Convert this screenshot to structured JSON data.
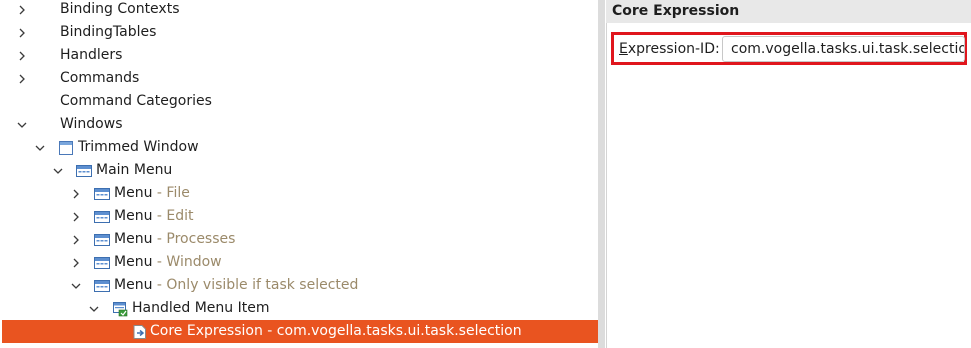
{
  "tree": {
    "items": [
      {
        "label": "Binding Contexts",
        "expander": "collapsed"
      },
      {
        "label": "BindingTables",
        "expander": "collapsed"
      },
      {
        "label": "Handlers",
        "expander": "collapsed"
      },
      {
        "label": "Commands",
        "expander": "collapsed"
      },
      {
        "label": "Command Categories",
        "expander": "none"
      },
      {
        "label": "Windows",
        "expander": "expanded"
      },
      {
        "label": "Trimmed Window",
        "icon": "window-icon",
        "expander": "expanded"
      },
      {
        "label": "Main Menu",
        "icon": "menu-icon",
        "expander": "expanded"
      },
      {
        "label": "Menu",
        "secondary": " - File",
        "icon": "menu-icon",
        "expander": "collapsed"
      },
      {
        "label": "Menu",
        "secondary": " - Edit",
        "icon": "menu-icon",
        "expander": "collapsed"
      },
      {
        "label": "Menu",
        "secondary": " - Processes",
        "icon": "menu-icon",
        "expander": "collapsed"
      },
      {
        "label": "Menu",
        "secondary": " - Window",
        "icon": "menu-icon",
        "expander": "collapsed"
      },
      {
        "label": "Menu",
        "secondary": " - Only visible if task selected",
        "icon": "menu-icon",
        "expander": "expanded"
      },
      {
        "label": "Handled Menu Item",
        "icon": "handled-menu-item-icon",
        "expander": "expanded"
      },
      {
        "label": "Core Expression - com.vogella.tasks.ui.task.selection",
        "icon": "core-expression-icon",
        "expander": "none",
        "selected": true
      }
    ]
  },
  "detail": {
    "header": "Core Expression",
    "expression_label_mnemonic": "E",
    "expression_label_rest": "xpression-ID:",
    "expression_value": "com.vogella.tasks.ui.task.selection"
  },
  "colors": {
    "selection": "#e95420",
    "secondary_text": "#9b8a6a",
    "highlight_border": "#e0161d"
  }
}
